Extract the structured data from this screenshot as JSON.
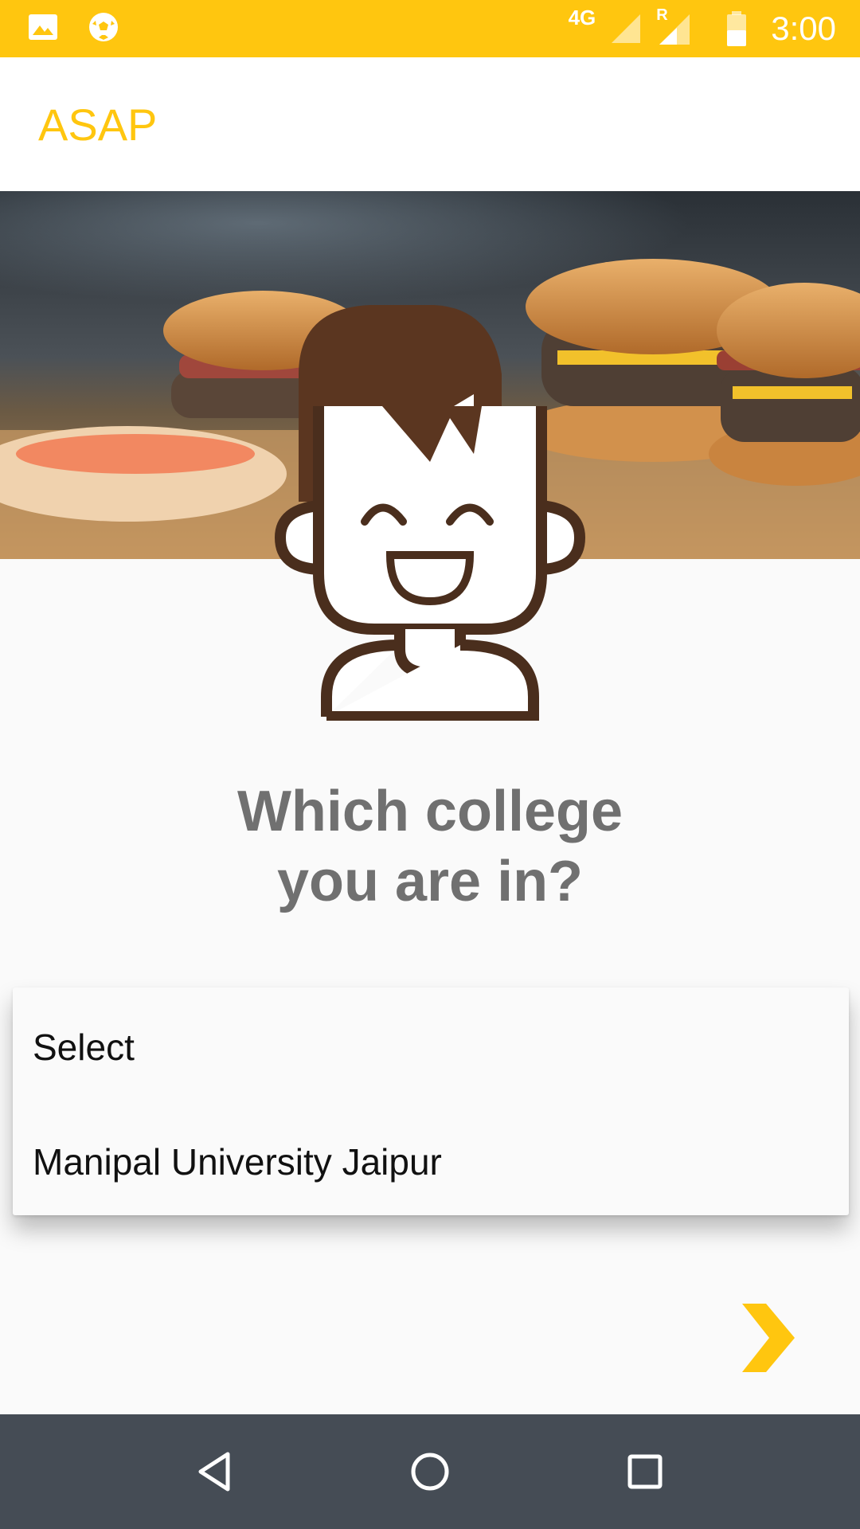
{
  "status_bar": {
    "background_color": "#FFC60F",
    "left_icons": [
      "image-notification-icon",
      "soccer-ball-icon"
    ],
    "network_label": "4G",
    "roaming_label": "R",
    "signal_icons": [
      "signal-icon",
      "signal-roaming-icon"
    ],
    "battery_icon": "battery-icon",
    "time": "3:00"
  },
  "app_bar": {
    "title": "ASAP",
    "title_color": "#FFC60F"
  },
  "hero": {
    "image": "burgers-photo"
  },
  "avatar": {
    "icon": "smiling-boy-avatar-icon"
  },
  "question": {
    "line1": "Which college",
    "line2": "you are in?"
  },
  "dropdown": {
    "options": [
      "Select",
      "Manipal University Jaipur"
    ]
  },
  "next_button": {
    "icon": "chevron-right-icon",
    "color": "#FFC60F"
  },
  "nav_bar": {
    "buttons": [
      "back-icon",
      "home-icon",
      "recents-icon"
    ]
  }
}
